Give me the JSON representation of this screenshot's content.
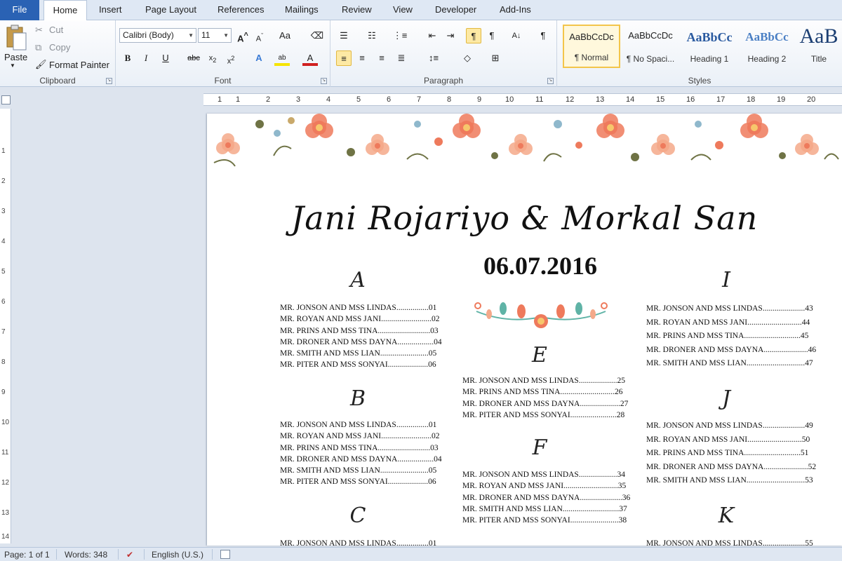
{
  "tabs": [
    "File",
    "Home",
    "Insert",
    "Page Layout",
    "References",
    "Mailings",
    "Review",
    "View",
    "Developer",
    "Add-Ins"
  ],
  "clipboard": {
    "paste": "Paste",
    "cut": "Cut",
    "copy": "Copy",
    "format_painter": "Format Painter",
    "group_label": "Clipboard"
  },
  "font": {
    "name": "Calibri (Body)",
    "size": "11",
    "group_label": "Font"
  },
  "paragraph": {
    "group_label": "Paragraph"
  },
  "styles": {
    "group_label": "Styles",
    "items": [
      {
        "sample": "AaBbCcDc",
        "name": "¶ Normal"
      },
      {
        "sample": "AaBbCcDc",
        "name": "¶ No Spaci..."
      },
      {
        "sample": "AaBbCc",
        "name": "Heading 1"
      },
      {
        "sample": "AaBbCc",
        "name": "Heading 2"
      },
      {
        "sample": "AaB",
        "name": "Title"
      }
    ]
  },
  "ruler": {
    "numbers": [
      "1",
      "1",
      "2",
      "3",
      "4",
      "5",
      "6",
      "7",
      "8",
      "9",
      "10",
      "11",
      "12",
      "13",
      "14",
      "15",
      "16",
      "17",
      "18",
      "19",
      "20"
    ]
  },
  "vruler": {
    "numbers": [
      "1",
      "2",
      "3",
      "4",
      "5",
      "6",
      "7",
      "8",
      "9",
      "10",
      "11",
      "12",
      "13",
      "14"
    ]
  },
  "document": {
    "couple": "Jani Rojariyo & Morkal San",
    "date": "06.07.2016",
    "sections": [
      {
        "letter": "A",
        "guests": [
          "MR. JONSON AND MSS LINDAS................01",
          "MR. ROYAN AND MSS JANI.........................02",
          "MR. PRINS AND MSS TINA..........................03",
          "MR. DRONER AND MSS DAYNA..................04",
          "MR. SMITH AND MSS LIAN........................05",
          "MR. PITER AND MSS SONYAI....................06"
        ]
      },
      {
        "letter": "B",
        "guests": [
          "MR. JONSON AND MSS LINDAS................01",
          "MR. ROYAN AND MSS JANI.........................02",
          "MR. PRINS AND MSS TINA..........................03",
          "MR. DRONER AND MSS DAYNA..................04",
          "MR. SMITH AND MSS LIAN........................05",
          "MR. PITER AND MSS SONYAI....................06"
        ]
      },
      {
        "letter": "C",
        "guests": [
          "MR. JONSON AND MSS LINDAS................01"
        ]
      },
      {
        "letter": "E",
        "guests": [
          "MR. JONSON AND MSS LINDAS...................25",
          "MR. PRINS AND MSS TINA...........................26",
          "MR. DRONER AND MSS DAYNA....................27",
          "MR. PITER AND MSS SONYAI.......................28"
        ]
      },
      {
        "letter": "F",
        "guests": [
          "MR. JONSON AND MSS LINDAS...................34",
          "MR. ROYAN AND MSS JANI...........................35",
          "MR. DRONER AND MSS DAYNA.....................36",
          "MR. SMITH AND MSS LIAN............................37",
          "MR. PITER AND MSS SONYAI........................38"
        ]
      },
      {
        "letter": "I",
        "guests": [
          "MR. JONSON AND MSS LINDAS.....................43",
          "MR. ROYAN AND MSS JANI...........................44",
          "MR. PRINS AND MSS TINA............................45",
          "MR. DRONER AND MSS DAYNA......................46",
          "MR. SMITH AND MSS LIAN.............................47"
        ]
      },
      {
        "letter": "J",
        "guests": [
          "MR. JONSON AND MSS LINDAS.....................49",
          "MR. ROYAN AND MSS JANI...........................50",
          "MR. PRINS AND MSS TINA............................51",
          "MR. DRONER AND MSS DAYNA......................52",
          "MR. SMITH AND MSS LIAN.............................53"
        ]
      },
      {
        "letter": "K",
        "guests": [
          "MR. JONSON AND MSS LINDAS.....................55"
        ]
      }
    ]
  },
  "status": {
    "page": "Page: 1 of 1",
    "words": "Words: 348",
    "language": "English (U.S.)"
  },
  "colors": {
    "file_tab": "#2a62b4",
    "flower_coral": "#ee7a5c",
    "flower_peach": "#f4a98a",
    "leaf_olive": "#6f7345",
    "berry_blue": "#8fb8cc",
    "accent_teal": "#5fb3a6"
  }
}
